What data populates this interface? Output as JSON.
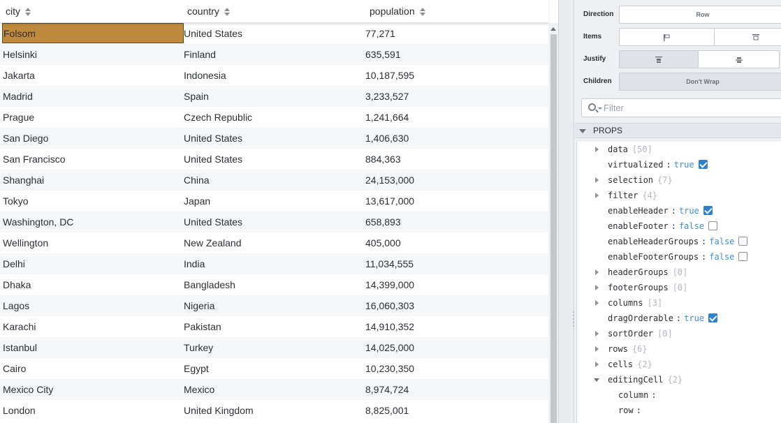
{
  "table": {
    "columns": [
      "city",
      "country",
      "population"
    ],
    "rows": [
      [
        "Folsom",
        "United States",
        "77,271"
      ],
      [
        "Helsinki",
        "Finland",
        "635,591"
      ],
      [
        "Jakarta",
        "Indonesia",
        "10,187,595"
      ],
      [
        "Madrid",
        "Spain",
        "3,233,527"
      ],
      [
        "Prague",
        "Czech Republic",
        "1,241,664"
      ],
      [
        "San Diego",
        "United States",
        "1,406,630"
      ],
      [
        "San Francisco",
        "United States",
        "884,363"
      ],
      [
        "Shanghai",
        "China",
        "24,153,000"
      ],
      [
        "Tokyo",
        "Japan",
        "13,617,000"
      ],
      [
        "Washington, DC",
        "United States",
        "658,893"
      ],
      [
        "Wellington",
        "New Zealand",
        "405,000"
      ],
      [
        "Delhi",
        "India",
        "11,034,555"
      ],
      [
        "Dhaka",
        "Bangladesh",
        "14,399,000"
      ],
      [
        "Lagos",
        "Nigeria",
        "16,060,303"
      ],
      [
        "Karachi",
        "Pakistan",
        "14,910,352"
      ],
      [
        "Istanbul",
        "Turkey",
        "14,025,000"
      ],
      [
        "Cairo",
        "Egypt",
        "10,230,350"
      ],
      [
        "Mexico City",
        "Mexico",
        "8,974,724"
      ],
      [
        "London",
        "United Kingdom",
        "8,825,001"
      ]
    ],
    "selected_cell": {
      "row": 0,
      "column": 0
    },
    "selected_color": "#c08a3e"
  },
  "layout_controls": {
    "direction": {
      "label": "Direction",
      "value": "Row"
    },
    "items": {
      "label": "Items",
      "icons": [
        "align-start-icon",
        "align-end-icon"
      ]
    },
    "justify": {
      "label": "Justify",
      "icons": [
        "justify-start-icon",
        "justify-center-icon"
      ],
      "active": 0
    },
    "children": {
      "label": "Children",
      "value": "Don't Wrap"
    }
  },
  "filter": {
    "placeholder": "Filter"
  },
  "props_section": {
    "label": "PROPS"
  },
  "props": [
    {
      "key": "data",
      "count": "[50]",
      "expandable": true
    },
    {
      "key": "virtualized",
      "value": "true",
      "checkbox": true,
      "checked": true
    },
    {
      "key": "selection",
      "count": "{7}",
      "expandable": true
    },
    {
      "key": "filter",
      "count": "{4}",
      "expandable": true
    },
    {
      "key": "enableHeader",
      "value": "true",
      "checkbox": true,
      "checked": true
    },
    {
      "key": "enableFooter",
      "value": "false",
      "checkbox": true,
      "checked": false
    },
    {
      "key": "enableHeaderGroups",
      "value": "false",
      "checkbox": true,
      "checked": false
    },
    {
      "key": "enableFooterGroups",
      "value": "false",
      "checkbox": true,
      "checked": false
    },
    {
      "key": "headerGroups",
      "count": "[0]",
      "expandable": true
    },
    {
      "key": "footerGroups",
      "count": "[0]",
      "expandable": true
    },
    {
      "key": "columns",
      "count": "[3]",
      "expandable": true
    },
    {
      "key": "dragOrderable",
      "value": "true",
      "checkbox": true,
      "checked": true
    },
    {
      "key": "sortOrder",
      "count": "[0]",
      "expandable": true
    },
    {
      "key": "rows",
      "count": "{6}",
      "expandable": true
    },
    {
      "key": "cells",
      "count": "{2}",
      "expandable": true
    },
    {
      "key": "editingCell",
      "count": "{2}",
      "expandable": true,
      "open": true
    },
    {
      "key": "column",
      "child": true,
      "value": ""
    },
    {
      "key": "row",
      "child": true,
      "value": ""
    }
  ]
}
